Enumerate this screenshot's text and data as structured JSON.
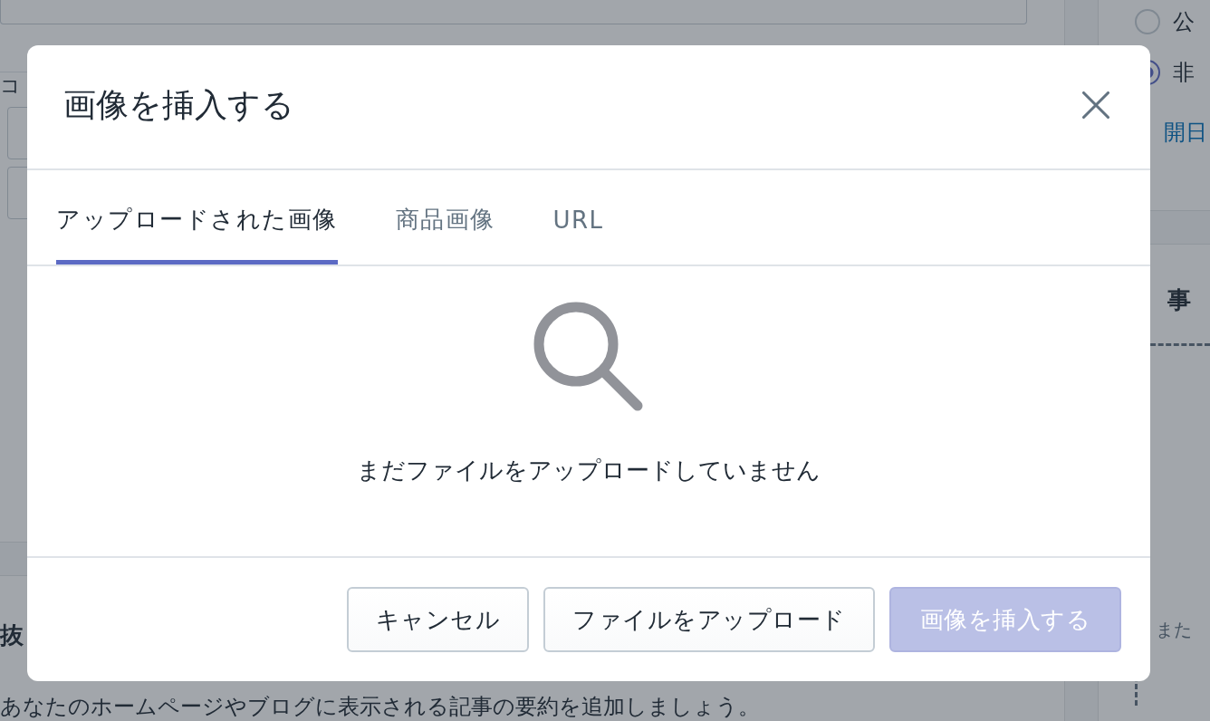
{
  "background": {
    "left_card": {
      "label_fragment": "コ"
    },
    "left_section": {
      "heading_fragment": "抜",
      "description": "あなたのホームページやブログに表示される記事の要約を追加しましょう。"
    },
    "visibility": {
      "options": [
        {
          "label": "公",
          "selected": false
        },
        {
          "label": "非",
          "selected": true
        }
      ],
      "link": "開日"
    },
    "image_card": {
      "heading_fragment": "事",
      "hint_fragment": "また"
    }
  },
  "dialog": {
    "title": "画像を挿入する",
    "tabs": [
      {
        "label": "アップロードされた画像",
        "selected": true
      },
      {
        "label": "商品画像",
        "selected": false
      },
      {
        "label": "URL",
        "selected": false
      }
    ],
    "empty_message": "まだファイルをアップロードしていません",
    "buttons": [
      {
        "label": "キャンセル",
        "kind": "secondary",
        "disabled": false
      },
      {
        "label": "ファイルをアップロード",
        "kind": "secondary",
        "disabled": false
      },
      {
        "label": "画像を挿入する",
        "kind": "primary",
        "disabled": true
      }
    ]
  }
}
